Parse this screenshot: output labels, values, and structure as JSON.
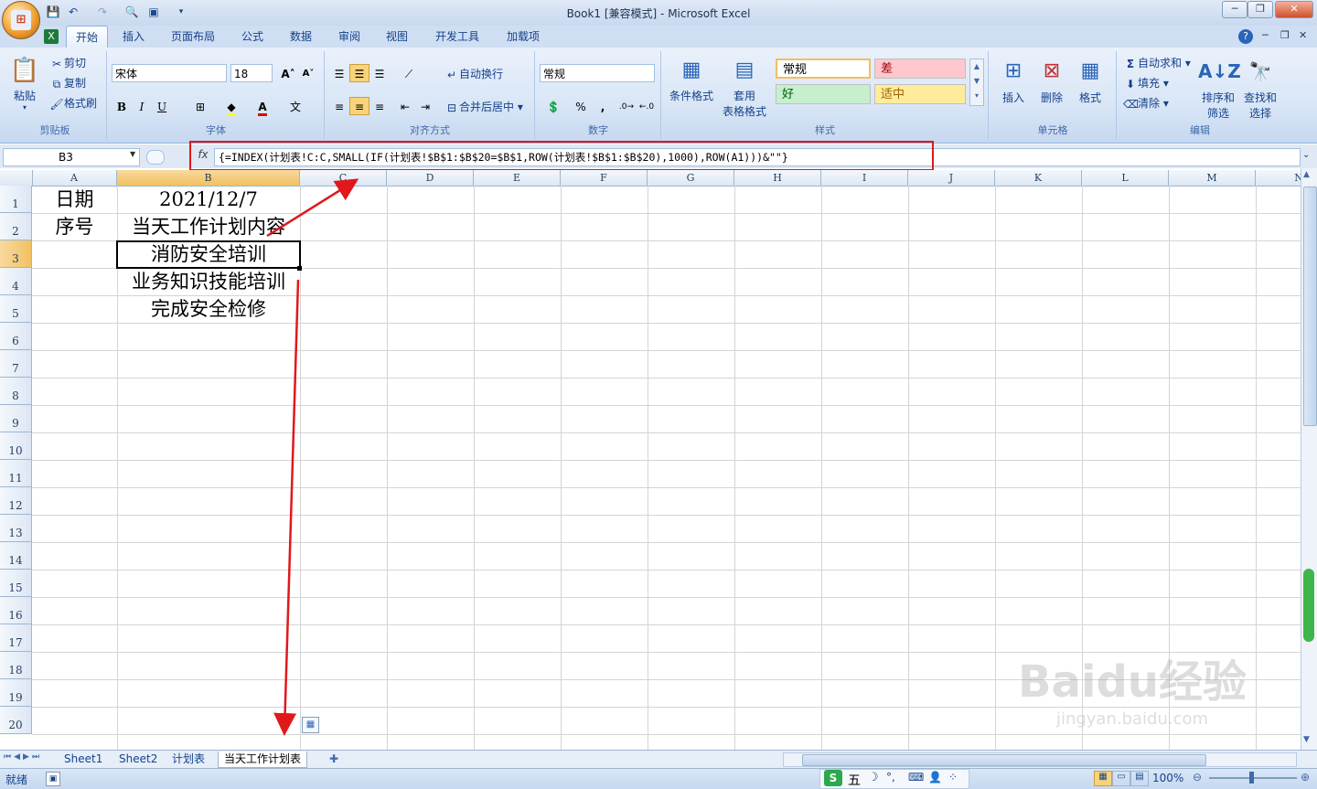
{
  "window": {
    "title": "Book1  [兼容模式] - Microsoft Excel",
    "controls": [
      "─",
      "❐",
      "✕"
    ]
  },
  "ribbon_tabs": [
    "开始",
    "插入",
    "页面布局",
    "公式",
    "数据",
    "审阅",
    "视图",
    "开发工具",
    "加载项"
  ],
  "active_tab": "开始",
  "clipboard": {
    "paste": "粘贴",
    "cut": "剪切",
    "copy": "复制",
    "format_painter": "格式刷",
    "label": "剪贴板"
  },
  "font": {
    "name": "宋体",
    "size": "18",
    "bold": "B",
    "italic": "I",
    "underline": "U",
    "label": "字体"
  },
  "alignment": {
    "wrap": "自动换行",
    "merge": "合并后居中",
    "label": "对齐方式"
  },
  "number": {
    "format": "常规",
    "percent": "%",
    "comma": ",",
    "label": "数字"
  },
  "styles": {
    "conditional": "条件格式",
    "table_format_1": "套用",
    "table_format_2": "表格格式",
    "normal": "常规",
    "bad": "差",
    "good": "好",
    "neutral": "适中",
    "label": "样式",
    "colors": {
      "bad_bg": "#ffc7ce",
      "bad_fg": "#9c0006",
      "good_bg": "#c6efce",
      "good_fg": "#006100",
      "neutral_bg": "#ffeb9c",
      "neutral_fg": "#9c6500"
    }
  },
  "cells_group": {
    "insert": "插入",
    "delete": "删除",
    "format": "格式",
    "label": "单元格"
  },
  "editing": {
    "autosum": "自动求和",
    "fill": "填充",
    "clear": "清除",
    "sort_1": "排序和",
    "sort_2": "筛选",
    "find_1": "查找和",
    "find_2": "选择",
    "label": "编辑"
  },
  "formula_bar": {
    "name_box": "B3",
    "fx": "fx",
    "formula": "{=INDEX(计划表!C:C,SMALL(IF(计划表!$B$1:$B$20=$B$1,ROW(计划表!$B$1:$B$20),1000),ROW(A1)))&\"\"}"
  },
  "columns": [
    "A",
    "B",
    "C",
    "D",
    "E",
    "F",
    "G",
    "H",
    "I",
    "J",
    "K",
    "L",
    "M",
    "N"
  ],
  "rows": [
    "1",
    "2",
    "3",
    "4",
    "5",
    "6",
    "7",
    "8",
    "9",
    "10",
    "11",
    "12",
    "13",
    "14",
    "15",
    "16",
    "17",
    "18",
    "19",
    "20"
  ],
  "cells": {
    "A1": "日期",
    "B1": "2021/12/7",
    "A2": "序号",
    "B2": "当天工作计划内容",
    "B3": "消防安全培训",
    "B4": "业务知识技能培训",
    "B5": "完成安全检修"
  },
  "sheets": [
    "Sheet1",
    "Sheet2",
    "计划表",
    "当天工作计划表"
  ],
  "active_sheet": "当天工作计划表",
  "status": {
    "ready": "就绪",
    "zoom": "100%",
    "ime": "五"
  },
  "watermark": {
    "brand": "Baidu经验",
    "url": "jingyan.baidu.com"
  }
}
